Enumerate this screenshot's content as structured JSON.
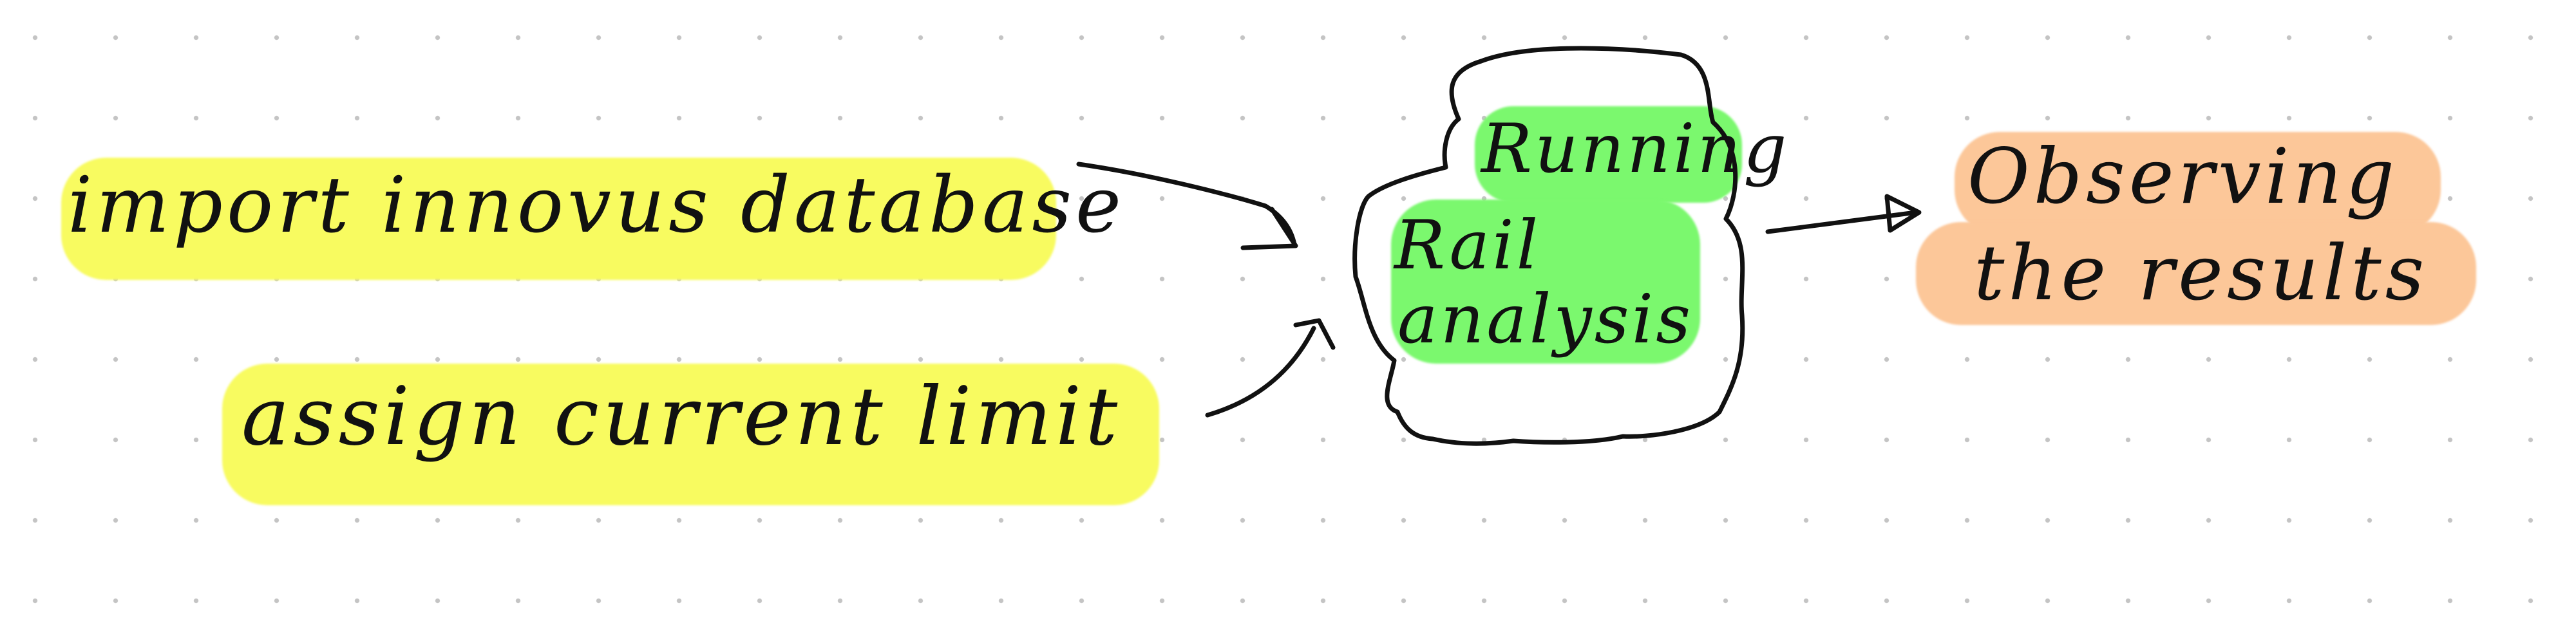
{
  "nodes": {
    "import": {
      "text": "import innovus database"
    },
    "assign": {
      "text": "assign current limit"
    },
    "process_line1": {
      "text": "Running"
    },
    "process_line2": {
      "text": "Rail"
    },
    "process_line3": {
      "text": "analysis"
    },
    "result_line1": {
      "text": "Observing"
    },
    "result_line2": {
      "text": "the results"
    }
  },
  "colors": {
    "input_highlight": "#f8fb60",
    "process_highlight": "#7bf86e",
    "result_highlight": "#fcc799",
    "ink": "#111111",
    "grid_dot": "#c4c4c4"
  }
}
